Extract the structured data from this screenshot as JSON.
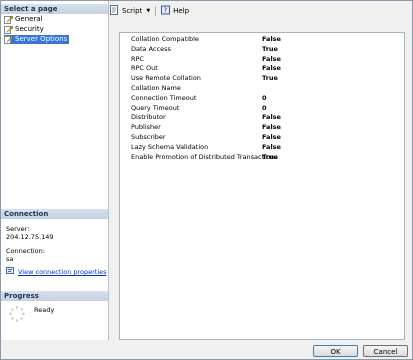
{
  "sidebar": {
    "select_page_header": "Select a page",
    "pages": [
      {
        "label": "General",
        "selected": false
      },
      {
        "label": "Security",
        "selected": false
      },
      {
        "label": "Server Options",
        "selected": true
      }
    ],
    "connection_header": "Connection",
    "server_label": "Server:",
    "server_value": "204.12.75.149",
    "connection_label": "Connection:",
    "connection_value": "sa",
    "view_connection_link": "View connection properties",
    "progress_header": "Progress",
    "progress_status": "Ready"
  },
  "toolbar": {
    "script_label": "Script",
    "help_label": "Help"
  },
  "properties": [
    {
      "name": "Collation Compatible",
      "value": "False"
    },
    {
      "name": "Data Access",
      "value": "True"
    },
    {
      "name": "RPC",
      "value": "False"
    },
    {
      "name": "RPC Out",
      "value": "False"
    },
    {
      "name": "Use Remote Collation",
      "value": "True"
    },
    {
      "name": "Collation Name",
      "value": ""
    },
    {
      "name": "Connection Timeout",
      "value": "0"
    },
    {
      "name": "Query Timeout",
      "value": "0"
    },
    {
      "name": "Distributor",
      "value": "False"
    },
    {
      "name": "Publisher",
      "value": "False"
    },
    {
      "name": "Subscriber",
      "value": "False"
    },
    {
      "name": "Lazy Schema Validation",
      "value": "False"
    },
    {
      "name": "Enable Promotion of Distributed Transactions",
      "value": "True"
    }
  ],
  "buttons": {
    "ok_label": "OK",
    "cancel_label": "Cancel"
  }
}
